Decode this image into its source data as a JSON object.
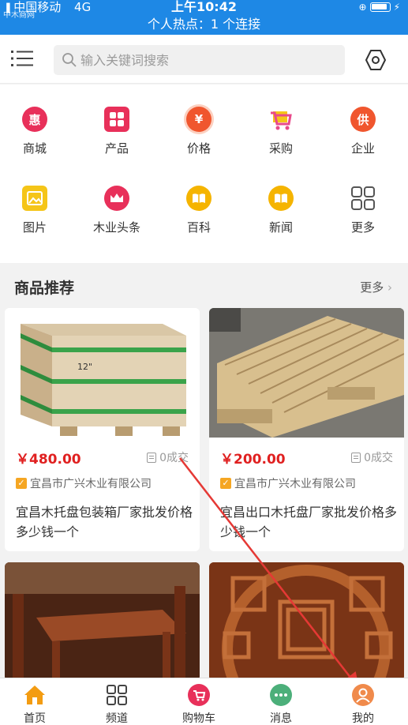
{
  "status_bar": {
    "carrier": "中国移动",
    "network": "4G",
    "time": "上午10:42",
    "watermark": "中木商网",
    "hotspot": "个人热点：1 个连接"
  },
  "header": {
    "search_placeholder": "输入关键词搜索"
  },
  "categories": [
    {
      "label": "商城",
      "icon": "hui-icon",
      "glyph": "惠",
      "color": "#e8305a"
    },
    {
      "label": "产品",
      "icon": "product-icon",
      "glyph": "",
      "color": "#e8305a"
    },
    {
      "label": "价格",
      "icon": "price-icon",
      "glyph": "¥",
      "color": "#f0562e"
    },
    {
      "label": "采购",
      "icon": "purchase-cart-icon",
      "glyph": "",
      "color": "#e84a8a"
    },
    {
      "label": "企业",
      "icon": "enterprise-icon",
      "glyph": "供",
      "color": "#f0562e"
    },
    {
      "label": "图片",
      "icon": "picture-icon",
      "glyph": "",
      "color": "#f5c518"
    },
    {
      "label": "木业头条",
      "icon": "crown-icon",
      "glyph": "",
      "color": "#e8305a"
    },
    {
      "label": "百科",
      "icon": "book-icon",
      "glyph": "",
      "color": "#f5b400"
    },
    {
      "label": "新闻",
      "icon": "news-icon",
      "glyph": "",
      "color": "#f5b400"
    },
    {
      "label": "更多",
      "icon": "more-grid-icon",
      "glyph": "",
      "color": "#666666"
    }
  ],
  "section": {
    "title": "商品推荐",
    "more": "更多"
  },
  "products": [
    {
      "price": "￥480.00",
      "deals": "0成交",
      "shop": "宜昌市广兴木业有限公司",
      "title": "宜昌木托盘包装箱厂家批发价格多少钱一个",
      "crate_label": "12\""
    },
    {
      "price": "￥200.00",
      "deals": "0成交",
      "shop": "宜昌市广兴木业有限公司",
      "title": "宜昌出口木托盘厂家批发价格多少钱一个"
    }
  ],
  "tabs": [
    {
      "label": "首页",
      "icon": "home-icon"
    },
    {
      "label": "频道",
      "icon": "channel-grid-icon"
    },
    {
      "label": "购物车",
      "icon": "cart-icon"
    },
    {
      "label": "消息",
      "icon": "message-icon"
    },
    {
      "label": "我的",
      "icon": "profile-icon"
    }
  ],
  "colors": {
    "status_bar": "#1e88e5",
    "price": "#e02020",
    "home_active": "#f39c12",
    "annotation_arrow": "#e53935"
  }
}
